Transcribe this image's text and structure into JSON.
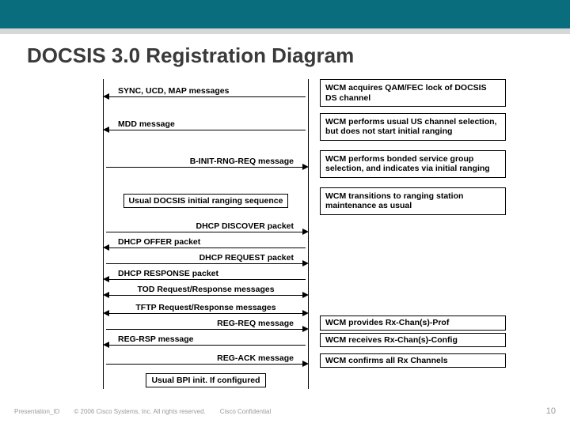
{
  "title": "DOCSIS 3.0 Registration Diagram",
  "rows": [
    {
      "messages": [
        {
          "dir": "left",
          "text": "SYNC, UCD, MAP messages"
        }
      ],
      "note": "WCM acquires QAM/FEC lock of DOCSIS DS channel"
    },
    {
      "messages": [
        {
          "dir": "left",
          "text": "MDD message"
        }
      ],
      "note": "WCM performs usual US channel selection, but does not start initial ranging"
    },
    {
      "messages": [
        {
          "dir": "right",
          "text": "B-INIT-RNG-REQ message"
        }
      ],
      "note": "WCM performs bonded service group selection, and indicates via initial ranging"
    },
    {
      "boxed": "Usual DOCSIS initial ranging sequence",
      "note": "WCM transitions to ranging station maintenance as usual"
    },
    {
      "messages": [
        {
          "dir": "right",
          "text": "DHCP DISCOVER  packet"
        },
        {
          "dir": "left",
          "text": "DHCP OFFER packet"
        },
        {
          "dir": "right",
          "text": "DHCP REQUEST packet"
        },
        {
          "dir": "left",
          "text": "DHCP RESPONSE packet"
        },
        {
          "dir": "both",
          "text": "TOD Request/Response messages"
        }
      ]
    },
    {
      "messages": [
        {
          "dir": "both",
          "text": "TFTP Request/Response messages"
        },
        {
          "dir": "right",
          "text": "REG-REQ message"
        },
        {
          "dir": "left",
          "text": "REG-RSP message"
        }
      ],
      "notes": [
        "WCM provides Rx-Chan(s)-Prof",
        "WCM receives Rx-Chan(s)-Config"
      ]
    },
    {
      "messages": [
        {
          "dir": "right",
          "text": "REG-ACK message"
        }
      ],
      "note": "WCM confirms all Rx Channels"
    },
    {
      "boxed": "Usual BPI init. If configured"
    }
  ],
  "footer": {
    "left": "Presentation_ID",
    "copyright": "© 2006 Cisco Systems, Inc. All rights reserved.",
    "confidential": "Cisco Confidential",
    "page": "10"
  }
}
